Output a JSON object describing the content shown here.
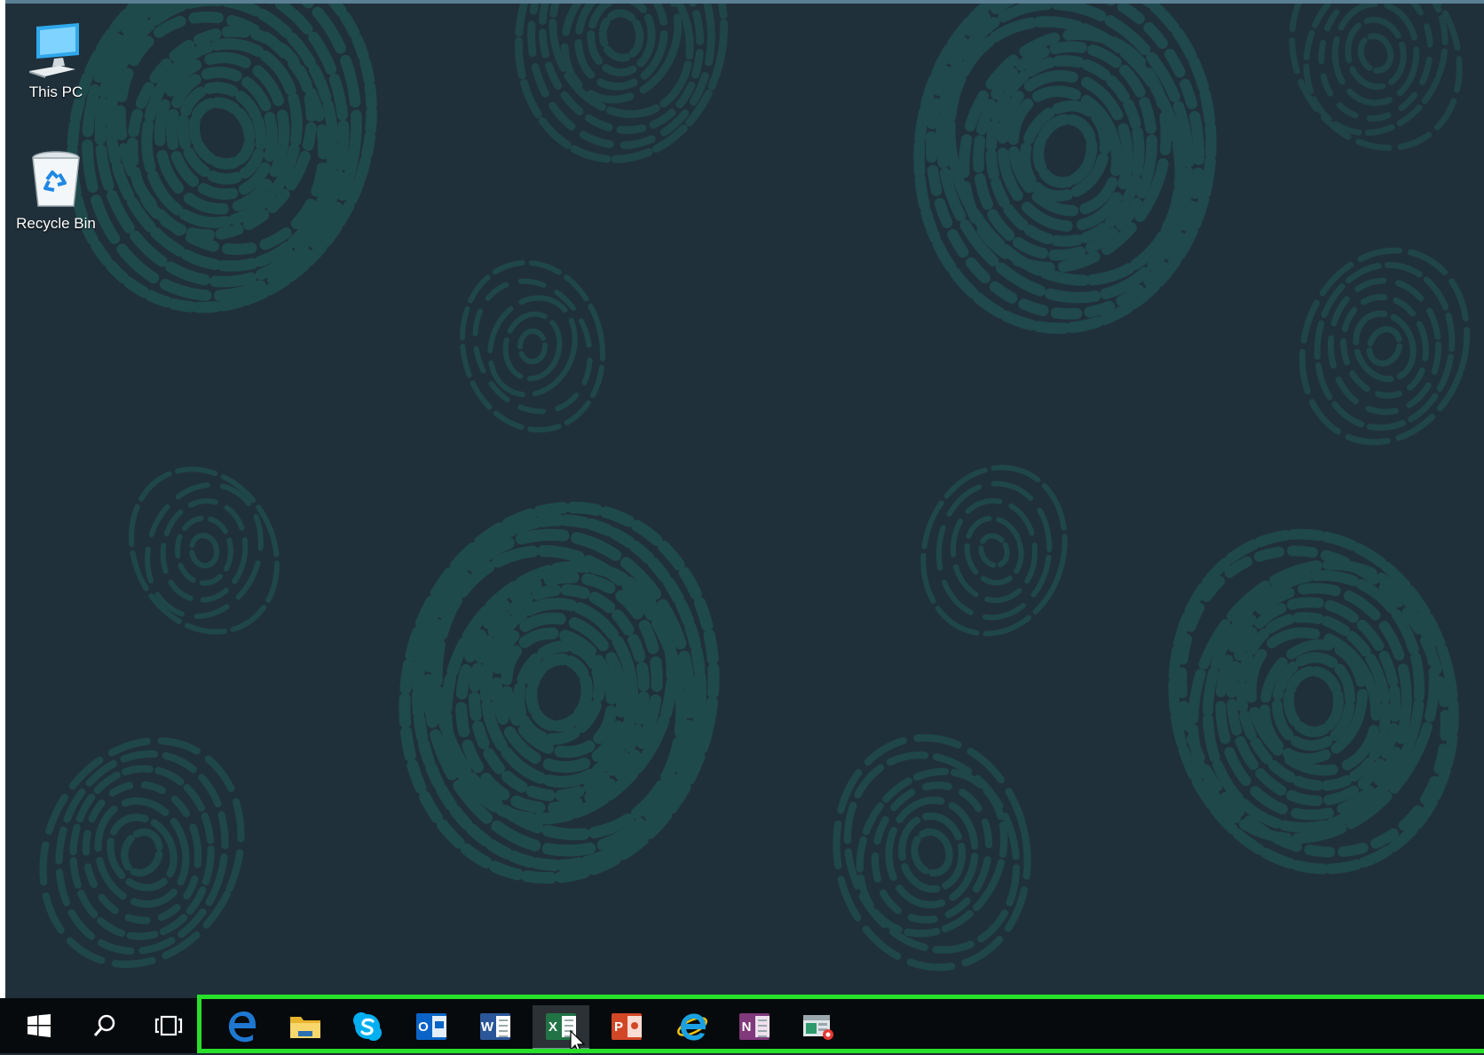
{
  "desktop": {
    "icons": [
      {
        "label": "This PC",
        "icon": "computer-icon"
      },
      {
        "label": "Recycle Bin",
        "icon": "recycle-bin-icon"
      }
    ],
    "wallpaper": {
      "theme": "fingerprints",
      "background": "#20303a",
      "pattern_color": "#1f5a58"
    }
  },
  "taskbar": {
    "start_icon": "windows-logo-icon",
    "search_icon": "search-icon",
    "task_view_icon": "task-view-icon",
    "pinned_apps": [
      {
        "name": "Microsoft Edge",
        "icon": "edge-icon",
        "color": "#1e78d2"
      },
      {
        "name": "File Explorer",
        "icon": "folder-icon",
        "color": "#f2c94c"
      },
      {
        "name": "Skype",
        "icon": "skype-icon",
        "color": "#00aff0"
      },
      {
        "name": "Outlook",
        "icon": "outlook-icon",
        "color": "#0a64c8",
        "letter": "O"
      },
      {
        "name": "Word",
        "icon": "word-icon",
        "color": "#2b579a",
        "letter": "W"
      },
      {
        "name": "Excel",
        "icon": "excel-icon",
        "color": "#217346",
        "letter": "X",
        "active": true
      },
      {
        "name": "PowerPoint",
        "icon": "powerpoint-icon",
        "color": "#d24726",
        "letter": "P"
      },
      {
        "name": "Internet Explorer",
        "icon": "internet-explorer-icon",
        "color": "#1ba1e2"
      },
      {
        "name": "OneNote",
        "icon": "onenote-icon",
        "color": "#80397b",
        "letter": "N"
      },
      {
        "name": "Remote Desktop",
        "icon": "remote-app-icon",
        "color": "#2f9a6b"
      }
    ],
    "highlight_color": "#27e02a"
  }
}
